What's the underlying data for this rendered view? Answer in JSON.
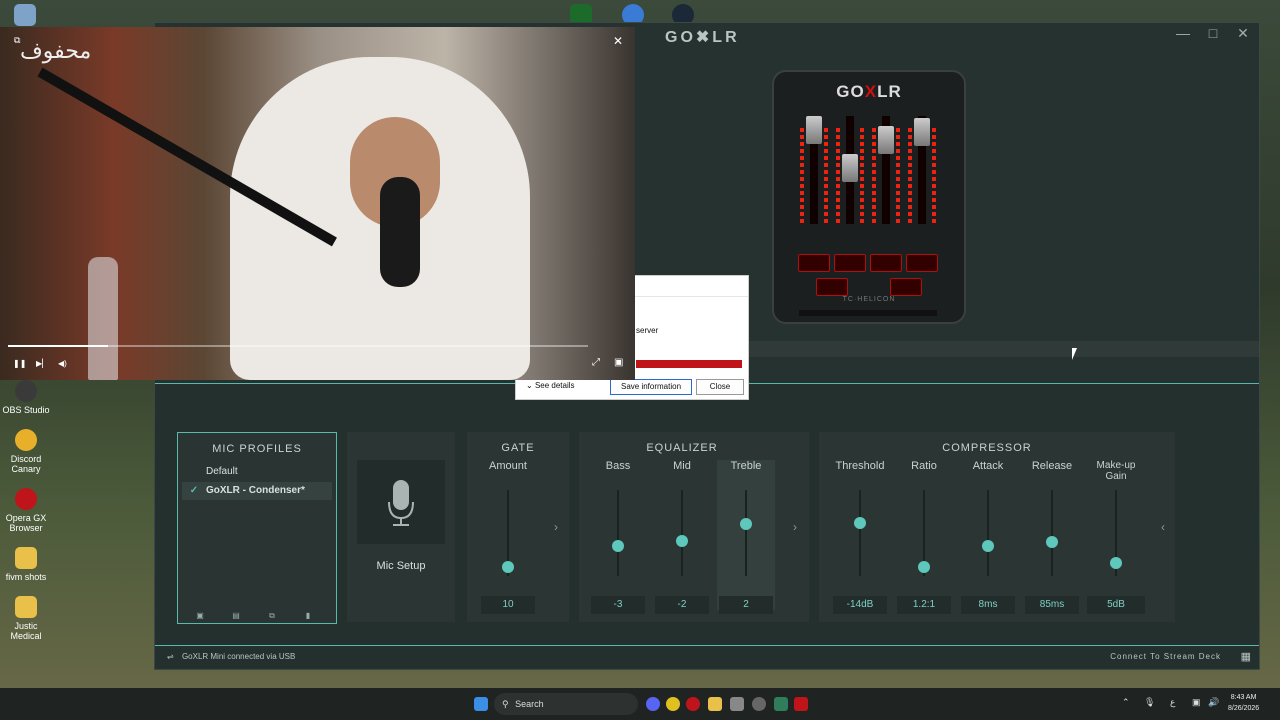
{
  "goxlr": {
    "title": "GO✖LR",
    "window_controls": {
      "minimize": "—",
      "maximize": "□",
      "close": "✕"
    },
    "device": {
      "logo_left": "GO",
      "logo_x": "X",
      "logo_right": "LR",
      "brand": "TC·HELICON"
    },
    "mic_profiles": {
      "title": "MIC PROFILES",
      "items": [
        {
          "label": "Default",
          "active": false
        },
        {
          "label": "GoXLR - Condenser*",
          "active": true,
          "check": "✓"
        }
      ],
      "tools": [
        "▣",
        "▤",
        "⧉",
        "▮"
      ]
    },
    "mic_setup": {
      "label": "Mic Setup"
    },
    "gate": {
      "title": "GATE",
      "controls": [
        {
          "label": "Amount",
          "value": "10",
          "level": 0.1
        }
      ]
    },
    "equalizer": {
      "title": "EQUALIZER",
      "controls": [
        {
          "label": "Bass",
          "value": "-3",
          "level": 0.35
        },
        {
          "label": "Mid",
          "value": "-2",
          "level": 0.41
        },
        {
          "label": "Treble",
          "value": "2",
          "level": 0.6
        }
      ]
    },
    "compressor": {
      "title": "COMPRESSOR",
      "controls": [
        {
          "label": "Threshold",
          "value": "-14dB",
          "level": 0.62
        },
        {
          "label": "Ratio",
          "value": "1.2:1",
          "level": 0.1
        },
        {
          "label": "Attack",
          "value": "8ms",
          "level": 0.35
        },
        {
          "label": "Release",
          "value": "85ms",
          "level": 0.4
        },
        {
          "label": "Make-up Gain",
          "value": "5dB",
          "level": 0.15
        }
      ]
    },
    "status": "GoXLR Mini connected via USB",
    "stream_deck": "Connect To Stream Deck",
    "arrows": {
      "right": "›",
      "left": "‹"
    }
  },
  "dialog": {
    "text": "server",
    "see_details": "See details",
    "save": "Save information",
    "close": "Close"
  },
  "video": {
    "caption": "محفوف",
    "close": "✕",
    "play": "❚❚",
    "next": "▶▏",
    "volume": "◀)",
    "pip_back": "⧉"
  },
  "desktop": {
    "icons": [
      {
        "label": "OBS Studio",
        "color": "#3a3a3a"
      },
      {
        "label": "Discord Canary",
        "color": "#e8b02a"
      },
      {
        "label": "Opera GX Browser",
        "color": "#c0141b"
      },
      {
        "label": "fivm shots",
        "color": "#e8c04a"
      },
      {
        "label": "Justic Medical",
        "color": "#e8c04a"
      }
    ]
  },
  "taskbar": {
    "search": "Search",
    "time": "8:43 AM",
    "date": "8/26/2026",
    "lang": "ع"
  }
}
